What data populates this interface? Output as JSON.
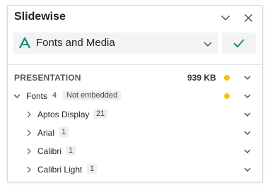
{
  "app": {
    "title": "Slidewise",
    "collapse_icon": "chevron-down-icon",
    "close_icon": "close-icon"
  },
  "selector": {
    "value": "Fonts and Media",
    "icon": "font-letter-a-icon",
    "accent": "#1e8f78",
    "apply_icon": "checkmark-icon"
  },
  "presentation": {
    "label": "PRESENTATION",
    "size": "939 KB",
    "status_color": "#f2c500"
  },
  "fonts": {
    "label": "Fonts",
    "count": "4",
    "note": "Not embedded",
    "status_color": "#f2c500",
    "items": [
      {
        "name": "Aptos Display",
        "count": "21"
      },
      {
        "name": "Arial",
        "count": "1"
      },
      {
        "name": "Calibri",
        "count": "1"
      },
      {
        "name": "Calibri Light",
        "count": "1"
      }
    ]
  }
}
